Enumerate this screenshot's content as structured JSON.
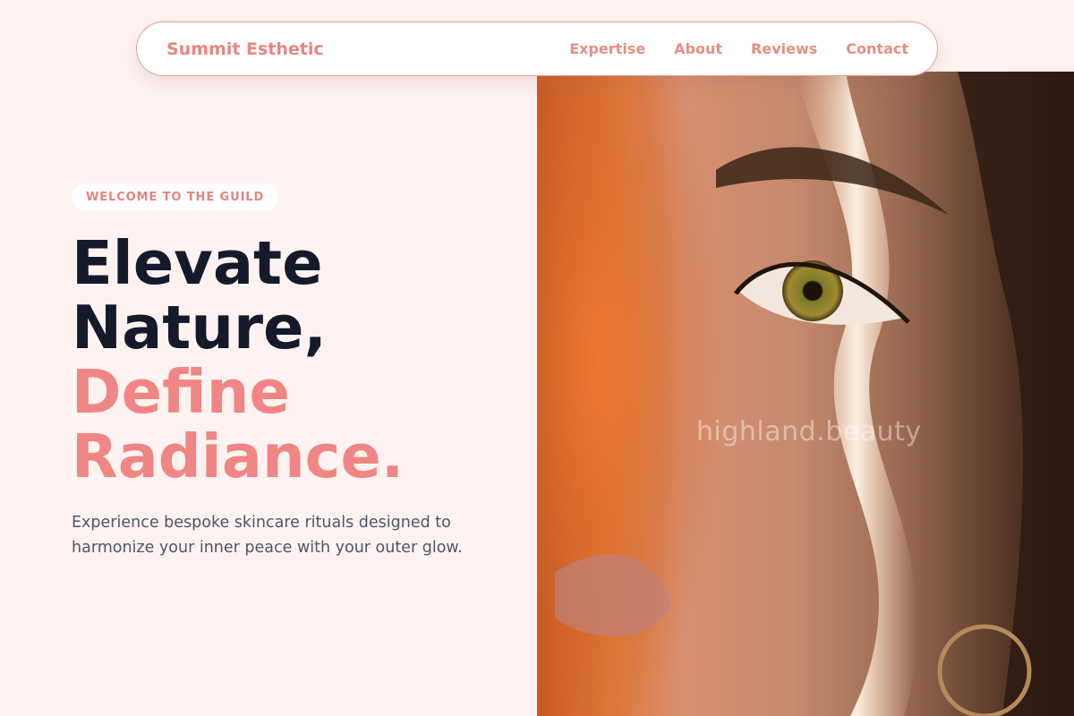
{
  "nav": {
    "brand": "Summit Esthetic",
    "links": [
      "Expertise",
      "About",
      "Reviews",
      "Contact"
    ]
  },
  "hero": {
    "badge": "WELCOME TO THE GUILD",
    "headline_line1": "Elevate",
    "headline_line2": "Nature,",
    "headline_line3": "Define",
    "headline_line4": "Radiance.",
    "subtext": "Experience bespoke skincare rituals designed to harmonize your inner peace with your outer glow.",
    "image_watermark": "highland.beauty"
  },
  "colors": {
    "accent": "#f08683",
    "heading_dark": "#141a2b",
    "background": "#fff3f2",
    "body_text": "#4e5565"
  }
}
